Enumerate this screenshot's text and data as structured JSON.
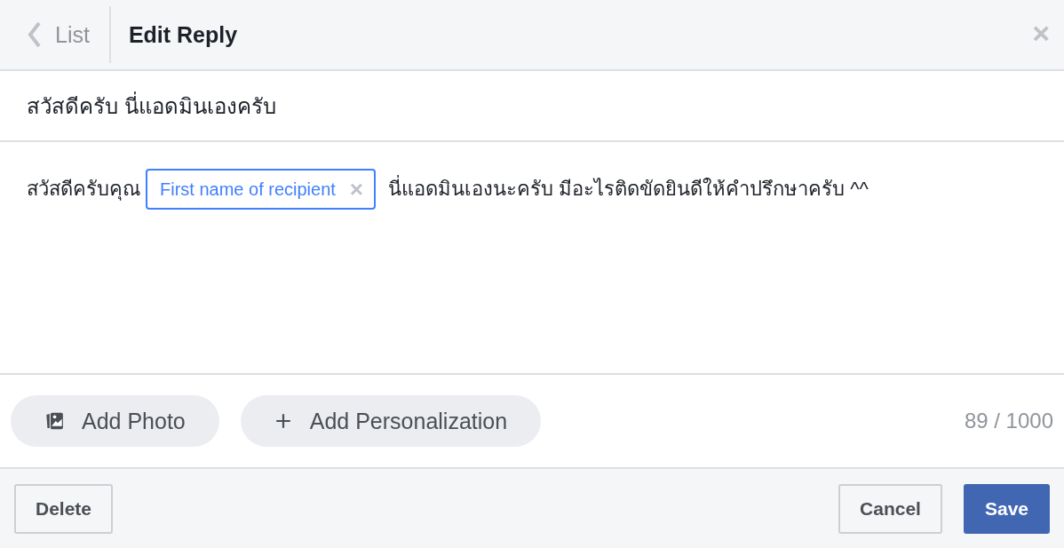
{
  "header": {
    "back_label": "List",
    "title": "Edit Reply",
    "close": "×"
  },
  "subject": {
    "value": "สวัสดีครับ นี่แอดมินเองครับ"
  },
  "message": {
    "parts": [
      {
        "kind": "text",
        "text": "สวัสดีครับคุณ"
      },
      {
        "kind": "token",
        "label": "First name of recipient",
        "remove": "×"
      },
      {
        "kind": "text",
        "text": "นี่แอดมินเองนะครับ มีอะไรติดขัดยินดีให้คำปรึกษาครับ ^^"
      }
    ]
  },
  "toolbar": {
    "buttons": [
      {
        "kind": "photo",
        "label": "Add Photo"
      },
      {
        "kind": "plus",
        "label": "Add Personalization"
      }
    ],
    "counter": "89 / 1000"
  },
  "footer": {
    "left": [
      {
        "kind": "secondary",
        "label": "Delete"
      }
    ],
    "right": [
      {
        "kind": "secondary",
        "label": "Cancel"
      },
      {
        "kind": "primary",
        "label": "Save"
      }
    ]
  }
}
